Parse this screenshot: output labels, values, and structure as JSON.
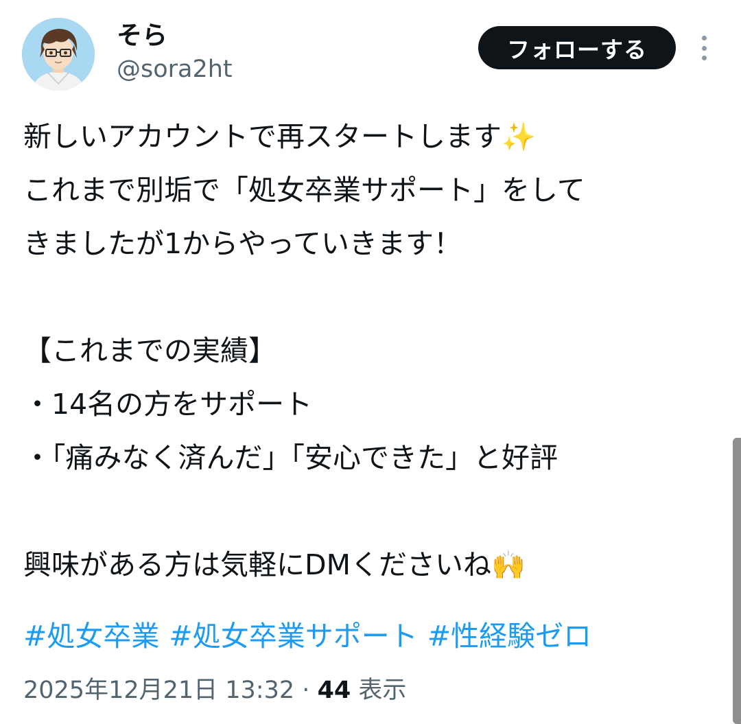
{
  "user": {
    "display_name": "そら",
    "handle": "@sora2ht",
    "avatar": "avatar-illustration"
  },
  "follow_button_label": "フォローする",
  "more_icon": "more-vertical-icon",
  "tweet": {
    "lines": [
      "新しいアカウントで再スタートします",
      "これまで別垢で「処女卒業サポート」をして",
      "きましたが1からやっていきます！",
      "",
      "【これまでの実績】",
      "・14名の方をサポート",
      "・「痛みなく済んだ」「安心できた」と好評",
      "",
      "興味がある方は気軽にDMくださいね"
    ],
    "emoji_sparkles": "✨",
    "emoji_raised_hands": "🙌",
    "hashtags": [
      "#処女卒業",
      "#処女卒業サポート",
      "#性経験ゼロ"
    ]
  },
  "meta": {
    "timestamp": "2025年12月21日 13:32",
    "separator": "·",
    "views_count": "44",
    "views_label": "表示"
  },
  "colors": {
    "text": "#0f1419",
    "secondary": "#536471",
    "link": "#1d9bf0",
    "button_bg": "#0f1419"
  }
}
